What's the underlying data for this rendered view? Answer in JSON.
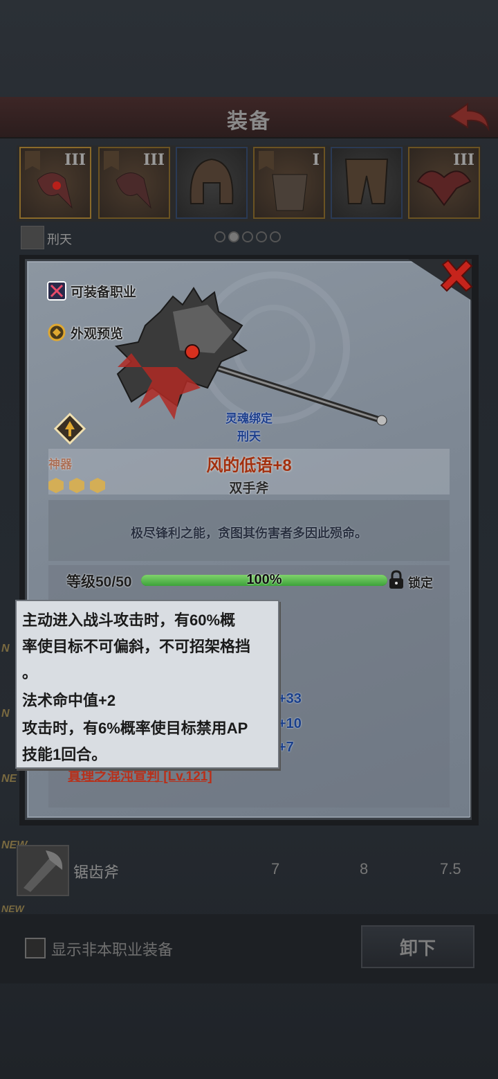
{
  "screen": {
    "title": "装备",
    "character_name": "刑天",
    "slot_tiers": [
      "III",
      "III",
      "",
      "I",
      "",
      "III"
    ],
    "page_dots": 5,
    "active_dot": 1
  },
  "list": {
    "rows": [
      {
        "tag": "NEW",
        "name": "锯齿斧",
        "v1": "7",
        "v2": "8",
        "v3": "7.5"
      },
      {
        "tag": "NEW",
        "name": "",
        "v1": "",
        "v2": "",
        "v3": ""
      }
    ],
    "side_tags": [
      "N",
      "N",
      "NE"
    ]
  },
  "footer": {
    "show_other_class_label": "显示非本职业装备",
    "unequip_label": "卸下"
  },
  "detail": {
    "equip_class_label": "可装备职业",
    "appearance_preview_label": "外观预览",
    "artifact_label": "神器",
    "gem_count": 3,
    "soul_bound_label": "灵魂绑定",
    "bound_to": "刑天",
    "item_name": "风的低语+8",
    "item_type": "双手斧",
    "description": "极尽锋利之能，贪图其伤害者多因此殒命。",
    "level_text": "等级50/50",
    "progress_percent_text": "100%",
    "progress_value": 1.0,
    "lock_label": "锁定",
    "stat_values": [
      "+33",
      "+10",
      "+7"
    ],
    "skill_text": "真理之混沌宣判 [Lv.121]",
    "colors": {
      "name": "#a2300f",
      "bound": "#1d3f8a",
      "bar": "#4fb845"
    }
  },
  "tooltip": {
    "lines": [
      "主动进入战斗攻击时，有60%概",
      "率使目标不可偏斜，不可招架格挡",
      "。",
      "法术命中值+2",
      "攻击时，有6%概率使目标禁用AP",
      "技能1回合。"
    ]
  }
}
